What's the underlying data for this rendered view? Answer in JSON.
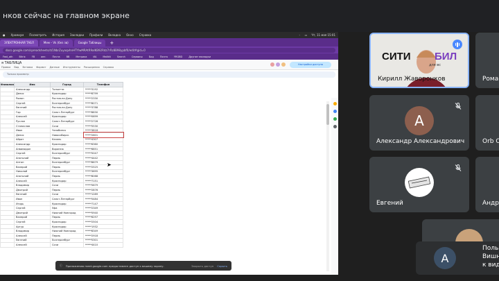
{
  "topbar": {
    "title": "нков сейчас на главном экране"
  },
  "shared_screen": {
    "mac_menu": [
      "Хромиум",
      "Посмотреть",
      "История",
      "Закладки",
      "Профили",
      "Вкладка",
      "Окно",
      "Справка"
    ],
    "clock": "Чт, 11 мая 15:01",
    "tabs": [
      {
        "label": "ЭЛЕКТРОННАЯ ТАБЛ"
      },
      {
        "label": "Мем – Vk (без зв)"
      },
      {
        "label": "Google Таблицы"
      }
    ],
    "url": "docs.google.com/spreadsheets/d/1NbrZuyoqvhnHTYlwMRAtR9aIKB92Rdz7rRz8B98ypbf0/edit#gid=0",
    "bookmarks": [
      "Fast_oth",
      "Bitrix",
      "FB",
      "авт.",
      "Почта",
      "ВВ",
      "Метрика",
      "ИА",
      "Mailkit",
      "Search",
      "Сервисы",
      "Бид",
      "Почта",
      "YRGBD",
      "Другие закладки"
    ],
    "doc_title": "я ТАБЛИЦА",
    "menu": [
      "Правка",
      "Вид",
      "Вставка",
      "Формат",
      "Данные",
      "Инструменты",
      "Расширения",
      "Справка"
    ],
    "share_label": "Настройки доступа",
    "toolbar_label": "Только просмотр",
    "columns": [
      "Фамилия",
      "Имя",
      "Город",
      "Телефон"
    ],
    "rows": [
      [
        "",
        "Александр",
        "Тольятти",
        "*****3192"
      ],
      [
        "",
        "Денис",
        "Краснодар",
        "*****8799"
      ],
      [
        "",
        "Роман",
        "Ростов-на-Дону",
        "*****2330"
      ],
      [
        "",
        "Сергей",
        "Екатеринбург",
        "*****8071"
      ],
      [
        "",
        "Евгений",
        "Ростов-на-Дону",
        "*****3788"
      ],
      [
        "",
        "Гор",
        "Санкт-Петербург",
        "*****8830"
      ],
      [
        "",
        "Алексей",
        "Краснодар",
        "*****0699"
      ],
      [
        "",
        "Руслан",
        "Санкт-Петербург",
        "*****2728"
      ],
      [
        "",
        "Станислав",
        "Сочи",
        "*****5530"
      ],
      [
        "",
        "Иван",
        "Челябинск",
        "*****3818"
      ],
      [
        "",
        "Денис",
        "Новосибирск",
        "*****2601"
      ],
      [
        "",
        "Айрат",
        "Казань",
        "*****4307"
      ],
      [
        "",
        "Александр",
        "Краснодар",
        "*****6360"
      ],
      [
        "",
        "Анвимидон",
        "Воронеж",
        "*****6851"
      ],
      [
        "",
        "Сергей",
        "Екатеринбург",
        "*****5047"
      ],
      [
        "",
        "Анатолий",
        "Пермь",
        "*****4442"
      ],
      [
        "",
        "Антон",
        "Екатеринбург",
        "*****8679"
      ],
      [
        "",
        "Валерий",
        "Пермь",
        "*****2525"
      ],
      [
        "",
        "Николай",
        "Екатеринбург",
        "*****3695"
      ],
      [
        "",
        "Анатолий",
        "Пермь",
        "*****8068"
      ],
      [
        "",
        "Алексей",
        "Краснодар",
        "*****7151"
      ],
      [
        "",
        "Владимир",
        "Сочи",
        "*****5679"
      ],
      [
        "",
        "Дмитрий",
        "Пермь",
        "*****2876"
      ],
      [
        "",
        "Евгений",
        "Сочи",
        "*****1289"
      ],
      [
        "",
        "Иван",
        "Санкт-Петербург",
        "*****5484"
      ],
      [
        "",
        "Игорь",
        "Краснодар",
        "*****7147"
      ],
      [
        "",
        "Сергей",
        "Уфа",
        "*****2349"
      ],
      [
        "",
        "Дмитрий",
        "Нижний Новгород",
        "*****5940"
      ],
      [
        "",
        "Валерий",
        "Пермь",
        "*****6297"
      ],
      [
        "",
        "Сергей",
        "Краснодар",
        "*****2504"
      ],
      [
        "",
        "Артур",
        "Краснодар",
        "*****1932"
      ],
      [
        "",
        "Владимир",
        "Нижний Новгород",
        "*****8349"
      ],
      [
        "",
        "Алексей",
        "Пермь",
        "*****2918"
      ],
      [
        "",
        "Евгений",
        "Екатеринбург",
        "*****5301"
      ],
      [
        "",
        "Алексей",
        "Сочи",
        "*****4410"
      ]
    ],
    "snackbar": {
      "text": "Приложению meet.google.com предоставлен доступ к вашему экрану.",
      "primary": "Закрыть доступ",
      "secondary": "Скрыть"
    }
  },
  "participants": [
    {
      "name": "Кирилл Жаворонков",
      "banner_text": "СИТИ",
      "banner_accent": "БИЛ",
      "banner_sub": "для вс"
    },
    {
      "name": "Роман"
    },
    {
      "name": "Александр Александрович",
      "initial": "А"
    },
    {
      "name": "Orb O"
    },
    {
      "name": "Евгений"
    },
    {
      "name": "Андр"
    },
    {
      "name": "Польз",
      "line2": "Вишн",
      "line3": "к вид",
      "initial": "А"
    }
  ],
  "colors": {
    "speaking_badge": "#4a88ff",
    "avatar_brown": "#8d5f4e",
    "avatar_slate": "#3c5067",
    "selection": "#c94040",
    "browser_purple": "#5a2d8a"
  }
}
